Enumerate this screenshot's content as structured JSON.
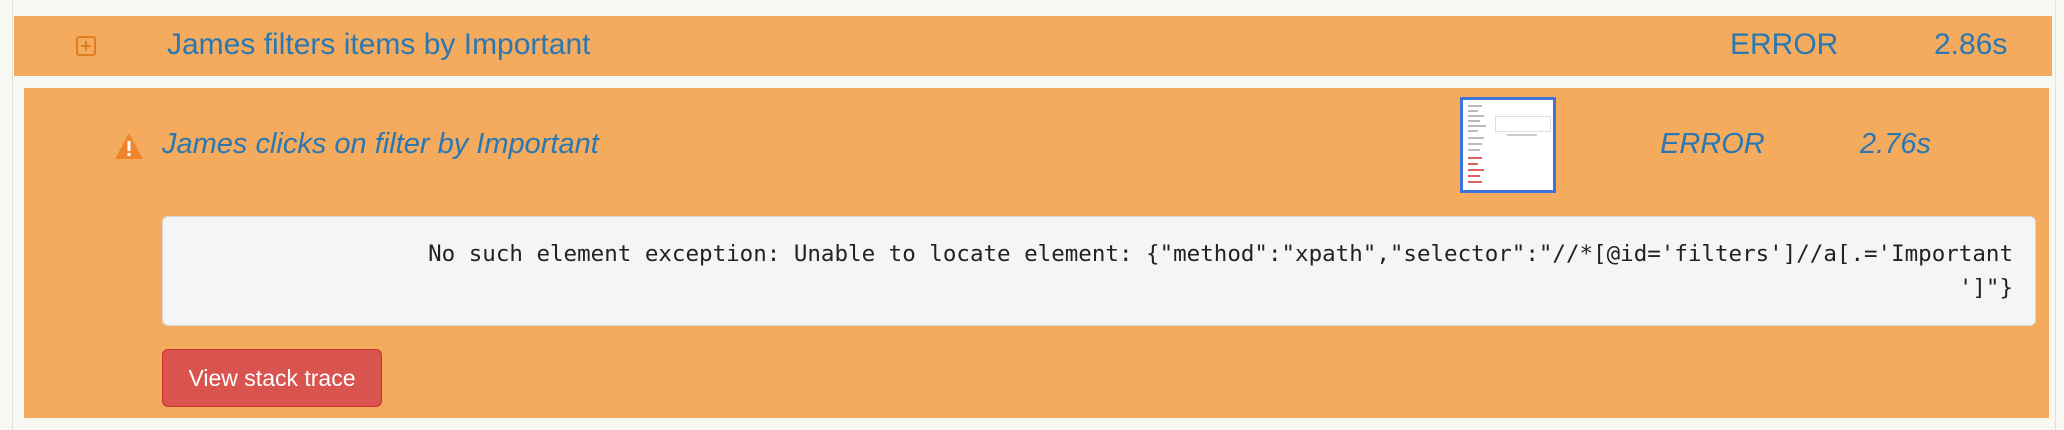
{
  "step": {
    "title": "James filters items by Important",
    "result": "ERROR",
    "duration": "2.86s",
    "expand_icon": "plus-square-icon"
  },
  "substep": {
    "title": "James clicks on filter by Important",
    "result": "ERROR",
    "duration": "2.76s",
    "status_icon": "warning-icon",
    "screenshot": "screenshot-thumbnail"
  },
  "error": {
    "message_line1": "No such element exception: Unable to locate element: {\"method\":\"xpath\",\"selector\":\"//*[@id='filters']//a[.='Important",
    "message_line2": "']\"}"
  },
  "buttons": {
    "stack_trace_label": "View stack trace"
  },
  "colors": {
    "row_background": "#f4ab5e",
    "text_link": "#2a77b2",
    "warning": "#f0842a",
    "danger_button": "#d9534f"
  }
}
